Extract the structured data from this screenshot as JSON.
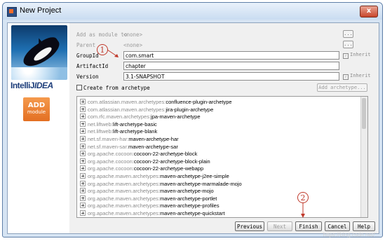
{
  "window": {
    "title": "New Project",
    "close_label": "x"
  },
  "left_panel": {
    "brand_plain": "IntelliJ",
    "brand_italic": "IDEA",
    "add_module_top": "ADD",
    "add_module_bottom": "module"
  },
  "form": {
    "add_as_module_label": "Add as module to",
    "add_as_module_value": "<none>",
    "parent_label": "Parent",
    "parent_value": "<none>",
    "group_id_label": "GroupId",
    "group_id_value": "com.smart",
    "artifact_id_label": "ArtifactId",
    "artifact_id_value": "chapter",
    "version_label": "Version",
    "version_value": "3.1-SNAPSHOT",
    "inherit_label": "Inherit",
    "browse_label": "...",
    "create_from_archetype_label": "Create from archetype",
    "add_archetype_label": "Add archetype..."
  },
  "archetypes": [
    {
      "group": "com.atlassian.maven.archetypes:",
      "artifact": "confluence-plugin-archetype"
    },
    {
      "group": "com.atlassian.maven.archetypes:",
      "artifact": "jira-plugin-archetype"
    },
    {
      "group": "com.rfc.maven.archetypes:",
      "artifact": "jpa-maven-archetype"
    },
    {
      "group": "net.liftweb:",
      "artifact": "lift-archetype-basic"
    },
    {
      "group": "net.liftweb:",
      "artifact": "lift-archetype-blank"
    },
    {
      "group": "net.sf.maven-har:",
      "artifact": "maven-archetype-har"
    },
    {
      "group": "net.sf.maven-sar:",
      "artifact": "maven-archetype-sar"
    },
    {
      "group": "org.apache.cocoon:",
      "artifact": "cocoon-22-archetype-block"
    },
    {
      "group": "org.apache.cocoon:",
      "artifact": "cocoon-22-archetype-block-plain"
    },
    {
      "group": "org.apache.cocoon:",
      "artifact": "cocoon-22-archetype-webapp"
    },
    {
      "group": "org.apache.maven.archetypes:",
      "artifact": "maven-archetype-j2ee-simple"
    },
    {
      "group": "org.apache.maven.archetypes:",
      "artifact": "maven-archetype-marmalade-mojo"
    },
    {
      "group": "org.apache.maven.archetypes:",
      "artifact": "maven-archetype-mojo"
    },
    {
      "group": "org.apache.maven.archetypes:",
      "artifact": "maven-archetype-portlet"
    },
    {
      "group": "org.apache.maven.archetypes:",
      "artifact": "maven-archetype-profiles"
    },
    {
      "group": "org.apache.maven.archetypes:",
      "artifact": "maven-archetype-quickstart"
    }
  ],
  "buttons": {
    "previous": "Previous",
    "next": "Next",
    "finish": "Finish",
    "cancel": "Cancel",
    "help": "Help"
  },
  "annotations": {
    "one": "1",
    "two": "2"
  },
  "watermark": "https://blog.csdn.net/...",
  "colors": {
    "annotation": "#c0392b",
    "window_frame": "#d6e4f3",
    "group_text": "#8a8a8a"
  }
}
